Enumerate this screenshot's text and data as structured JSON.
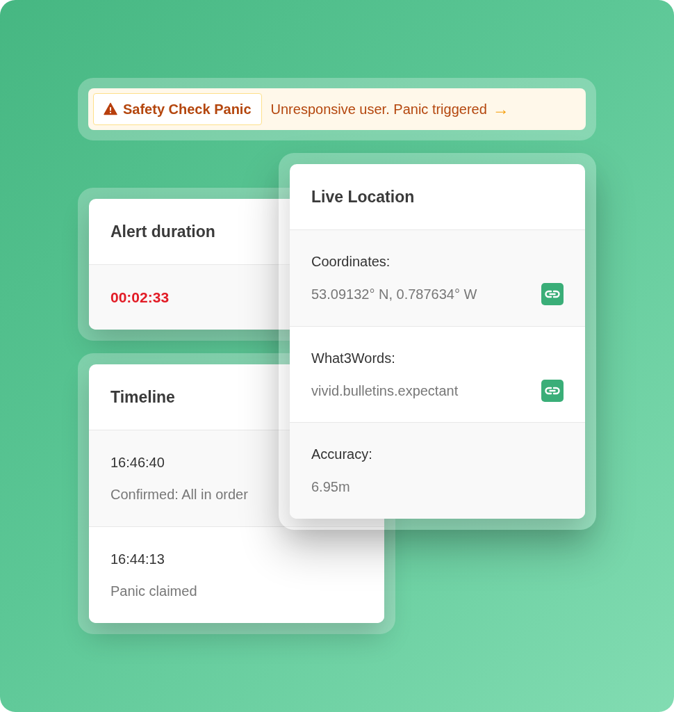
{
  "alert_banner": {
    "badge": "Safety Check Panic",
    "message": "Unresponsive user. Panic triggered",
    "arrow": "→"
  },
  "alert_duration": {
    "title": "Alert duration",
    "value": "00:02:33"
  },
  "timeline": {
    "title": "Timeline",
    "entries": [
      {
        "time": "16:46:40",
        "text": "Confirmed: All in order"
      },
      {
        "time": "16:44:13",
        "text": "Panic claimed"
      }
    ]
  },
  "live_location": {
    "title": "Live Location",
    "fields": [
      {
        "label": "Coordinates:",
        "value": "53.09132° N, 0.787634° W",
        "link": true
      },
      {
        "label": "What3Words:",
        "value": "vivid.bulletins.expectant",
        "link": true
      },
      {
        "label": "Accuracy:",
        "value": "6.95m",
        "link": false
      }
    ]
  }
}
